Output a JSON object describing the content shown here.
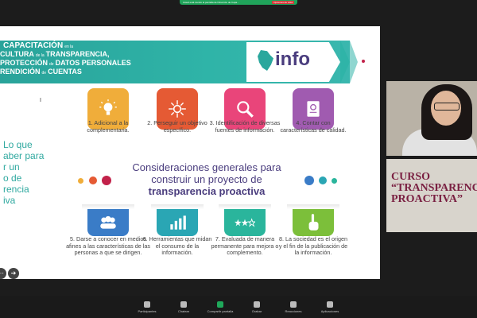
{
  "share_bar": {
    "message": "Usted está viendo la pantalla de Dirección de Capa...",
    "options_label": "Opciones de vista"
  },
  "slide": {
    "banner": {
      "line1": {
        "main": "CAPACITACIÓN",
        "small": "en la"
      },
      "line2": {
        "main": "CULTURA",
        "small": "de la",
        "main2": "TRANSPARENCIA,"
      },
      "line3": {
        "main": "PROTECCIÓN",
        "small": "de",
        "main2": "DATOS PERSONALES"
      },
      "line4": {
        "main": "RENDICIÓN",
        "small": "de",
        "main2": "CUENTAS"
      },
      "logo_text": "info"
    },
    "left_text": "Lo que\naber para\nr un\no de\nrencia\niva",
    "cards_top": [
      {
        "text": "1. Adicional a la complementaria.",
        "color": "#f0ad3a",
        "icon": "lightbulb-icon"
      },
      {
        "text": "2. Perseguir un objetivo específico.",
        "color": "#e55a34",
        "icon": "target-icon"
      },
      {
        "text": "3. Identificación de diversas fuentes de información.",
        "color": "#e9457a",
        "icon": "magnifier-icon"
      },
      {
        "text": "4. Contar con características de calidad.",
        "color": "#a05bb0",
        "icon": "certificate-icon"
      }
    ],
    "cards_bottom": [
      {
        "text": "5. Darse a conocer en medios afines a las características de las personas a que se dirigen.",
        "color": "#3a7cc7",
        "icon": "people-icon"
      },
      {
        "text": "6. Herramientas que midan el consumo de la información.",
        "color": "#2aa6b4",
        "icon": "bar-chart-icon"
      },
      {
        "text": "7. Evaluada de manera permanente para mejora o complemento.",
        "color": "#2ab59c",
        "icon": "stars-icon"
      },
      {
        "text": "8. La sociedad es el origen y el fin de la publicación de la información.",
        "color": "#7cbf3a",
        "icon": "pointing-hand-icon"
      }
    ],
    "center": {
      "line1": "Consideraciones generales para",
      "line2": "construir un proyecto de",
      "line3": "transparencia proactiva"
    }
  },
  "video": {
    "course_line1": "CURSO",
    "course_line2": "“TRANSPARENC",
    "course_line3": "PROACTIVA”"
  },
  "toolbar": {
    "items": [
      {
        "label": "Participantes"
      },
      {
        "label": "Chatear"
      },
      {
        "label": "Compartir pantalla"
      },
      {
        "label": "Grabar"
      },
      {
        "label": "Reacciones"
      },
      {
        "label": "Aplicaciones"
      }
    ]
  }
}
